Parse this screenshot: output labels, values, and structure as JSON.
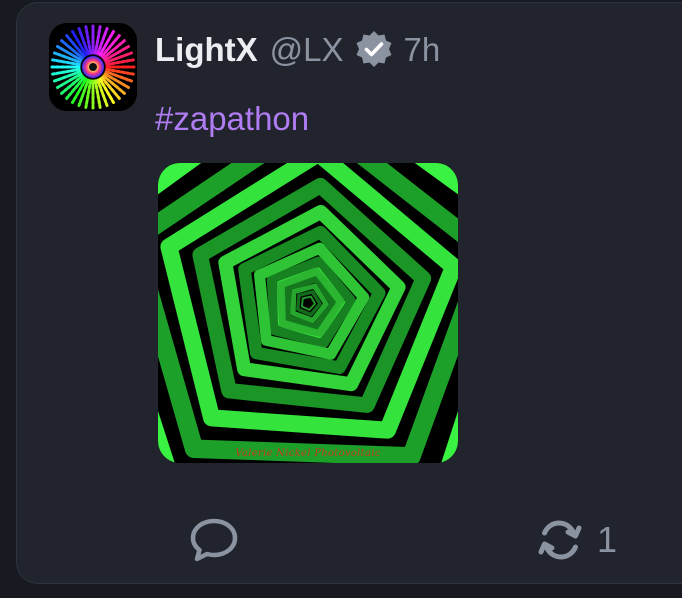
{
  "post": {
    "author_name": "LightX",
    "handle": "@LX",
    "timestamp": "7h",
    "hashtag": "#zapathon",
    "image_caption": "Valerie Nickel Photovoltaic",
    "repost_count": "1"
  },
  "icons": {
    "verified": "verified-check-badge-icon",
    "reply": "speech-bubble-icon",
    "repost": "circular-arrows-icon"
  },
  "colors": {
    "background": "#171a21",
    "card": "#21242d",
    "text_primary": "#eceef2",
    "text_secondary": "#8b93a1",
    "hashtag": "#b07cf2",
    "icon": "#8b93a1"
  }
}
